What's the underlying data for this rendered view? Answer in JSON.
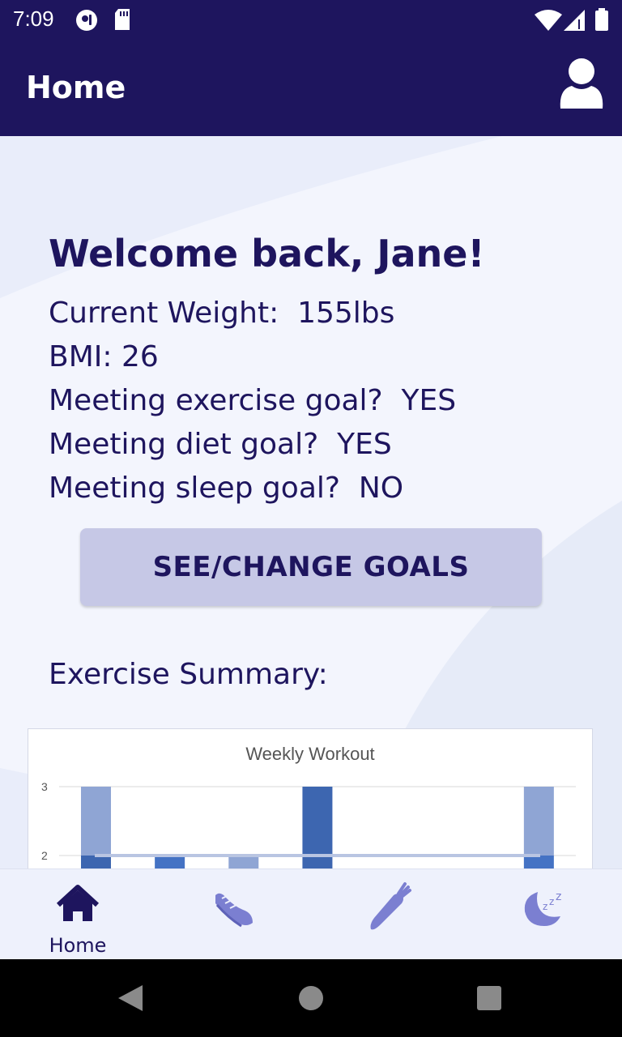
{
  "status_bar": {
    "time": "7:09",
    "left_icons": [
      "podcast-app-icon",
      "sd-card-icon"
    ],
    "right_icons": [
      "wifi-icon",
      "cell-signal-icon",
      "battery-icon"
    ]
  },
  "app_bar": {
    "title": "Home",
    "profile_icon": "user-profile-icon"
  },
  "welcome": {
    "heading": "Welcome back, Jane!",
    "stats": [
      "Current Weight:  155lbs",
      "BMI: 26",
      "Meeting exercise goal?  YES",
      "Meeting diet goal?  YES",
      "Meeting sleep goal?  NO"
    ]
  },
  "goals_button": {
    "label": "SEE/CHANGE GOALS"
  },
  "exercise": {
    "section_title": "Exercise Summary:"
  },
  "chart_data": {
    "type": "bar",
    "title": "Weekly Workout",
    "y_ticks_visible": [
      "3",
      "2"
    ],
    "bars_visible_top": [
      3,
      2,
      2,
      3,
      null,
      null,
      3
    ],
    "trend_line_value": 2,
    "colors": {
      "light_bar": "#8fa5d4",
      "dark_bar": "#3d66b0",
      "mid_bar": "#4472c4",
      "trend": "#b9c5e2",
      "grid": "#d9d9d9"
    }
  },
  "bottom_nav": {
    "items": [
      {
        "label": "Home",
        "icon": "home-icon",
        "active": true
      },
      {
        "label": "",
        "icon": "running-shoe-icon",
        "active": false
      },
      {
        "label": "",
        "icon": "carrot-icon",
        "active": false
      },
      {
        "label": "",
        "icon": "moon-sleep-icon",
        "active": false
      }
    ]
  },
  "colors": {
    "primary": "#1e155e",
    "background": "#eef1fc",
    "button": "#c6c8e6",
    "nav_inactive": "#7b7fd1"
  }
}
